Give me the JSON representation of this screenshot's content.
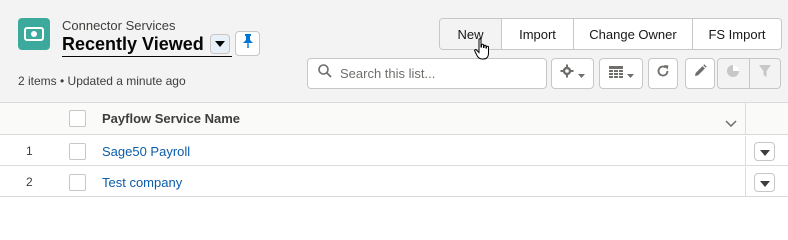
{
  "header": {
    "object_label": "Connector Services",
    "list_title": "Recently Viewed",
    "meta": "2 items • Updated a minute ago",
    "icon": "connector-service-icon"
  },
  "actions": {
    "new_label": "New",
    "import_label": "Import",
    "change_owner_label": "Change Owner",
    "fs_import_label": "FS Import"
  },
  "search": {
    "placeholder": "Search this list...",
    "value": ""
  },
  "toolbar": {
    "settings_icon": "gear-icon",
    "display_icon": "table-icon",
    "refresh_icon": "refresh-icon",
    "edit_icon": "pencil-icon",
    "chart_icon": "pie-chart-icon",
    "filter_icon": "filter-icon"
  },
  "table": {
    "columns": [
      {
        "label": "Payflow Service Name"
      }
    ],
    "rows": [
      {
        "num": "1",
        "name": "Sage50 Payroll"
      },
      {
        "num": "2",
        "name": "Test company"
      }
    ]
  },
  "colors": {
    "brand_icon": "#3ba99c",
    "link": "#0b5cab",
    "pin": "#0176d3"
  }
}
